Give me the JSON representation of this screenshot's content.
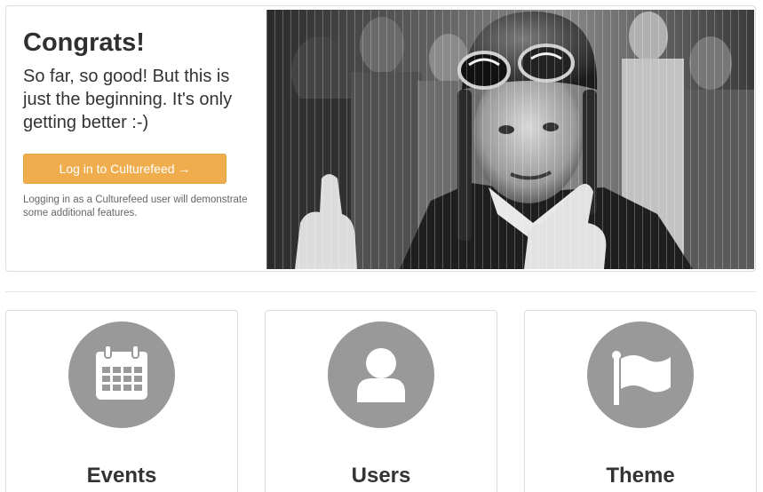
{
  "hero": {
    "title": "Congrats!",
    "lead": "So far, so good! But this is just the beginning. It's only getting better :-)",
    "login_button": "Log in to Culturefeed →",
    "note": "Logging in as a Culturefeed user will demonstrate some additional features.",
    "accent_color": "#f0ad4e"
  },
  "cards": [
    {
      "title": "Events",
      "icon": "calendar-icon"
    },
    {
      "title": "Users",
      "icon": "user-icon"
    },
    {
      "title": "Theme",
      "icon": "flag-icon"
    }
  ],
  "colors": {
    "icon_circle": "#999999",
    "text": "#333333"
  }
}
